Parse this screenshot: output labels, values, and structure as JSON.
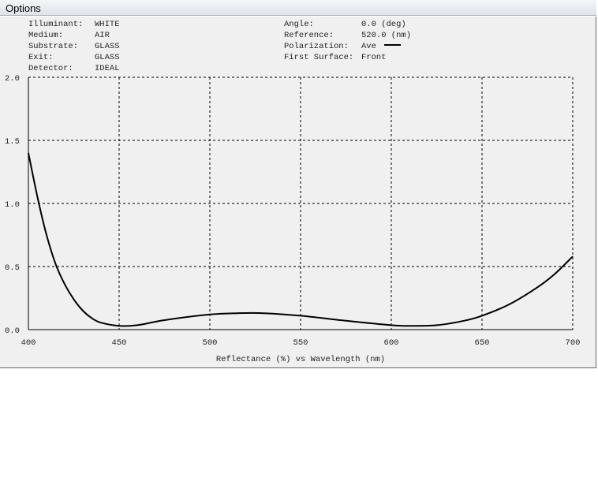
{
  "window": {
    "title": "Options"
  },
  "info_left": [
    {
      "label": "Illuminant:",
      "value": "WHITE"
    },
    {
      "label": "Medium:",
      "value": "AIR"
    },
    {
      "label": "Substrate:",
      "value": "GLASS"
    },
    {
      "label": "Exit:",
      "value": "GLASS"
    },
    {
      "label": "Detector:",
      "value": "IDEAL"
    }
  ],
  "info_right": [
    {
      "label": "Angle:",
      "value": "0.0 (deg)"
    },
    {
      "label": "Reference:",
      "value": "520.0 (nm)"
    },
    {
      "label": "Polarization:",
      "value": "Ave"
    },
    {
      "label": "First Surface:",
      "value": "Front"
    }
  ],
  "chart_data": {
    "type": "line",
    "title": "",
    "xlabel": "Reflectance (%)  vs  Wavelength (nm)",
    "ylabel": "",
    "xlim": [
      400,
      700
    ],
    "ylim": [
      0,
      2.0
    ],
    "xticks": [
      "400",
      "450",
      "500",
      "550",
      "600",
      "650",
      "700"
    ],
    "yticks": [
      "0.0",
      "0.5",
      "1.0",
      "1.5",
      "2.0"
    ],
    "grid": true,
    "series": [
      {
        "name": "Ave",
        "color": "#000000",
        "x": [
          400,
          405,
          410,
          415,
          420,
          425,
          430,
          435,
          440,
          450,
          460,
          475,
          500,
          515,
          530,
          550,
          575,
          600,
          610,
          625,
          640,
          650,
          665,
          680,
          690,
          700
        ],
        "y": [
          1.4,
          1.05,
          0.75,
          0.52,
          0.36,
          0.24,
          0.15,
          0.09,
          0.055,
          0.03,
          0.035,
          0.075,
          0.12,
          0.13,
          0.13,
          0.11,
          0.07,
          0.035,
          0.03,
          0.035,
          0.07,
          0.11,
          0.2,
          0.33,
          0.44,
          0.58
        ]
      }
    ]
  }
}
